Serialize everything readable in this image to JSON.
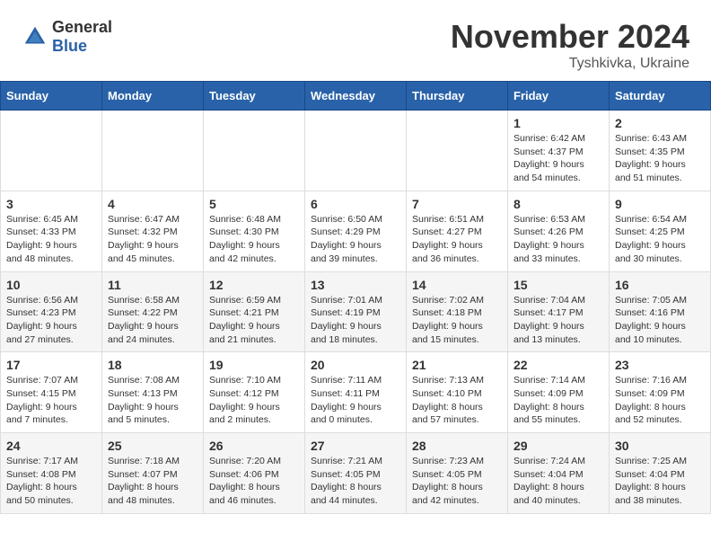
{
  "header": {
    "logo_general": "General",
    "logo_blue": "Blue",
    "month_title": "November 2024",
    "location": "Tyshkivka, Ukraine"
  },
  "columns": [
    "Sunday",
    "Monday",
    "Tuesday",
    "Wednesday",
    "Thursday",
    "Friday",
    "Saturday"
  ],
  "weeks": [
    [
      {
        "day": "",
        "info": ""
      },
      {
        "day": "",
        "info": ""
      },
      {
        "day": "",
        "info": ""
      },
      {
        "day": "",
        "info": ""
      },
      {
        "day": "",
        "info": ""
      },
      {
        "day": "1",
        "info": "Sunrise: 6:42 AM\nSunset: 4:37 PM\nDaylight: 9 hours\nand 54 minutes."
      },
      {
        "day": "2",
        "info": "Sunrise: 6:43 AM\nSunset: 4:35 PM\nDaylight: 9 hours\nand 51 minutes."
      }
    ],
    [
      {
        "day": "3",
        "info": "Sunrise: 6:45 AM\nSunset: 4:33 PM\nDaylight: 9 hours\nand 48 minutes."
      },
      {
        "day": "4",
        "info": "Sunrise: 6:47 AM\nSunset: 4:32 PM\nDaylight: 9 hours\nand 45 minutes."
      },
      {
        "day": "5",
        "info": "Sunrise: 6:48 AM\nSunset: 4:30 PM\nDaylight: 9 hours\nand 42 minutes."
      },
      {
        "day": "6",
        "info": "Sunrise: 6:50 AM\nSunset: 4:29 PM\nDaylight: 9 hours\nand 39 minutes."
      },
      {
        "day": "7",
        "info": "Sunrise: 6:51 AM\nSunset: 4:27 PM\nDaylight: 9 hours\nand 36 minutes."
      },
      {
        "day": "8",
        "info": "Sunrise: 6:53 AM\nSunset: 4:26 PM\nDaylight: 9 hours\nand 33 minutes."
      },
      {
        "day": "9",
        "info": "Sunrise: 6:54 AM\nSunset: 4:25 PM\nDaylight: 9 hours\nand 30 minutes."
      }
    ],
    [
      {
        "day": "10",
        "info": "Sunrise: 6:56 AM\nSunset: 4:23 PM\nDaylight: 9 hours\nand 27 minutes."
      },
      {
        "day": "11",
        "info": "Sunrise: 6:58 AM\nSunset: 4:22 PM\nDaylight: 9 hours\nand 24 minutes."
      },
      {
        "day": "12",
        "info": "Sunrise: 6:59 AM\nSunset: 4:21 PM\nDaylight: 9 hours\nand 21 minutes."
      },
      {
        "day": "13",
        "info": "Sunrise: 7:01 AM\nSunset: 4:19 PM\nDaylight: 9 hours\nand 18 minutes."
      },
      {
        "day": "14",
        "info": "Sunrise: 7:02 AM\nSunset: 4:18 PM\nDaylight: 9 hours\nand 15 minutes."
      },
      {
        "day": "15",
        "info": "Sunrise: 7:04 AM\nSunset: 4:17 PM\nDaylight: 9 hours\nand 13 minutes."
      },
      {
        "day": "16",
        "info": "Sunrise: 7:05 AM\nSunset: 4:16 PM\nDaylight: 9 hours\nand 10 minutes."
      }
    ],
    [
      {
        "day": "17",
        "info": "Sunrise: 7:07 AM\nSunset: 4:15 PM\nDaylight: 9 hours\nand 7 minutes."
      },
      {
        "day": "18",
        "info": "Sunrise: 7:08 AM\nSunset: 4:13 PM\nDaylight: 9 hours\nand 5 minutes."
      },
      {
        "day": "19",
        "info": "Sunrise: 7:10 AM\nSunset: 4:12 PM\nDaylight: 9 hours\nand 2 minutes."
      },
      {
        "day": "20",
        "info": "Sunrise: 7:11 AM\nSunset: 4:11 PM\nDaylight: 9 hours\nand 0 minutes."
      },
      {
        "day": "21",
        "info": "Sunrise: 7:13 AM\nSunset: 4:10 PM\nDaylight: 8 hours\nand 57 minutes."
      },
      {
        "day": "22",
        "info": "Sunrise: 7:14 AM\nSunset: 4:09 PM\nDaylight: 8 hours\nand 55 minutes."
      },
      {
        "day": "23",
        "info": "Sunrise: 7:16 AM\nSunset: 4:09 PM\nDaylight: 8 hours\nand 52 minutes."
      }
    ],
    [
      {
        "day": "24",
        "info": "Sunrise: 7:17 AM\nSunset: 4:08 PM\nDaylight: 8 hours\nand 50 minutes."
      },
      {
        "day": "25",
        "info": "Sunrise: 7:18 AM\nSunset: 4:07 PM\nDaylight: 8 hours\nand 48 minutes."
      },
      {
        "day": "26",
        "info": "Sunrise: 7:20 AM\nSunset: 4:06 PM\nDaylight: 8 hours\nand 46 minutes."
      },
      {
        "day": "27",
        "info": "Sunrise: 7:21 AM\nSunset: 4:05 PM\nDaylight: 8 hours\nand 44 minutes."
      },
      {
        "day": "28",
        "info": "Sunrise: 7:23 AM\nSunset: 4:05 PM\nDaylight: 8 hours\nand 42 minutes."
      },
      {
        "day": "29",
        "info": "Sunrise: 7:24 AM\nSunset: 4:04 PM\nDaylight: 8 hours\nand 40 minutes."
      },
      {
        "day": "30",
        "info": "Sunrise: 7:25 AM\nSunset: 4:04 PM\nDaylight: 8 hours\nand 38 minutes."
      }
    ]
  ]
}
